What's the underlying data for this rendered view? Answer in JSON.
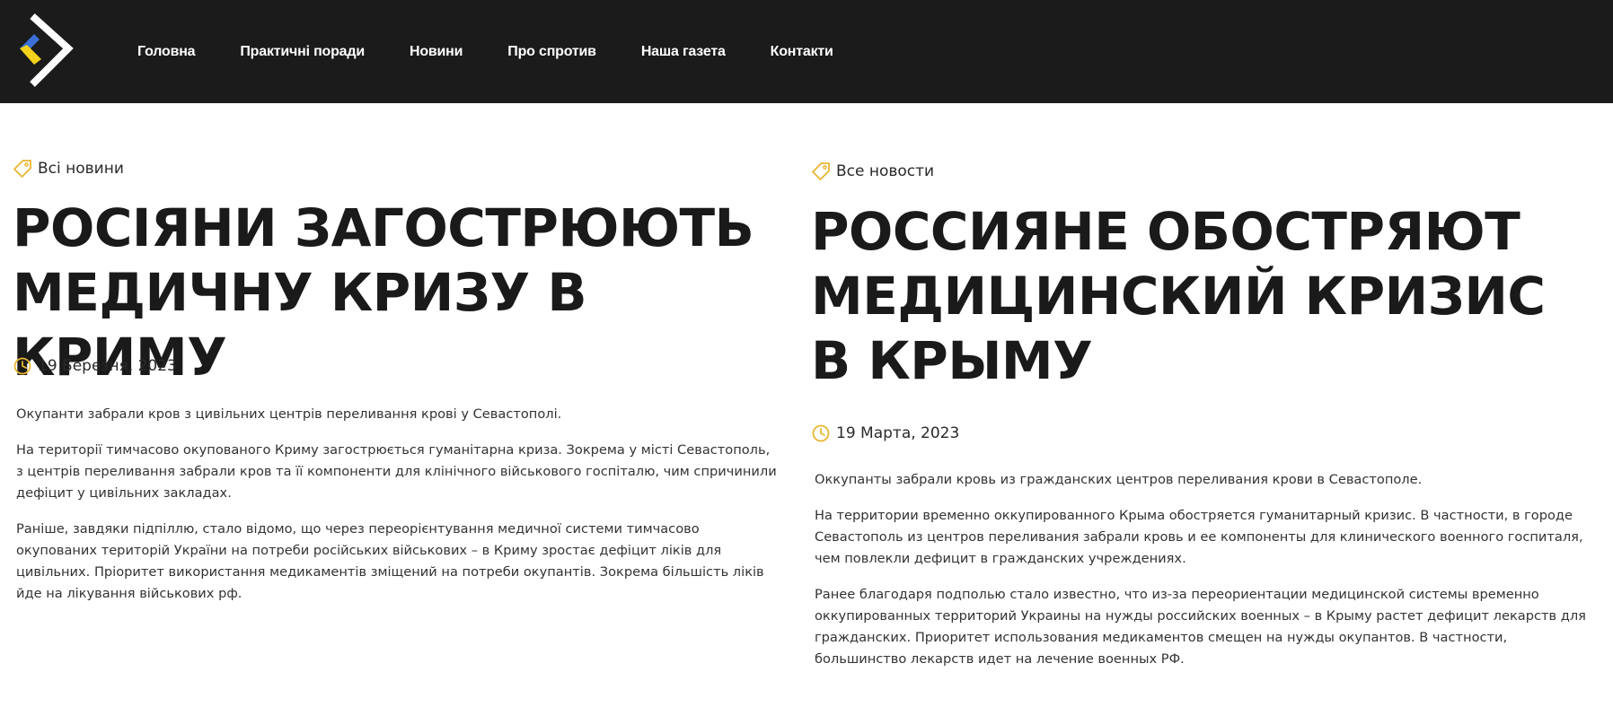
{
  "nav": {
    "items": [
      {
        "label": "Головна"
      },
      {
        "label": "Практичні поради"
      },
      {
        "label": "Новини"
      },
      {
        "label": "Про спротив"
      },
      {
        "label": "Наша газета"
      },
      {
        "label": "Контакти"
      }
    ]
  },
  "colors": {
    "topbar": "#1b1b1b",
    "accent_yellow": "#e8b630",
    "logo_blue": "#3b6fd6",
    "logo_yellow": "#f2d21c"
  },
  "icons": {
    "tag": "tag-icon",
    "clock": "clock-icon",
    "logo": "logo-icon"
  },
  "articles": [
    {
      "tag_label": "Всі новини",
      "title": "Росіяни загострюють медичну кризу в Криму",
      "date": "19 Березня, 2023",
      "paragraphs": [
        "Окупанти забрали кров з цивільних центрів переливання крові у Севастополі.",
        "На території тимчасово окупованого Криму загострюється гуманітарна криза. Зокрема у місті Севастополь, з центрів переливання забрали кров та її компоненти для клінічного військового госпіталю, чим спричинили дефіцит у цивільних закладах.",
        "Раніше, завдяки підпіллю, стало відомо, що через переорієнтування медичної системи тимчасово окупованих територій України на потреби російських військових – в Криму зростає дефіцит ліків для цивільних. Пріоритет використання медикаментів зміщений на потреби окупантів. Зокрема більшість ліків йде на лікування військових рф."
      ]
    },
    {
      "tag_label": "Все новости",
      "title": "Россияне обостряют медицинский кризис в Крыму",
      "date": "19 Марта, 2023",
      "paragraphs": [
        "Оккупанты забрали кровь из гражданских центров переливания крови в Севастополе.",
        "На территории временно оккупированного Крыма обостряется гуманитарный кризис. В частности, в городе Севастополь из центров переливания забрали кровь и ее компоненты для клинического военного госпиталя, чем повлекли дефицит в гражданских учреждениях.",
        "Ранее благодаря подполью стало известно, что из-за переориентации медицинской системы временно оккупированных территорий Украины на нужды российских военных – в Крыму растет дефицит лекарств для гражданских. Приоритет использования медикаментов смещен на нужды окупантов. В частности, большинство лекарств идет на лечение военных РФ."
      ]
    }
  ]
}
